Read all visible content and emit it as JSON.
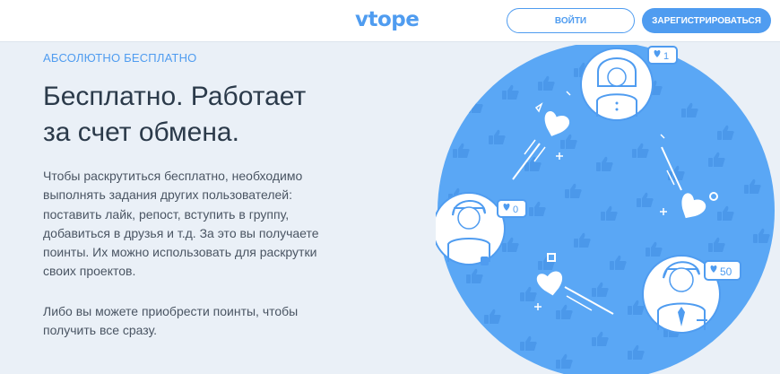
{
  "header": {
    "logo": "vtope",
    "login_label": "ВОЙТИ",
    "register_label": "ЗАРЕГИСТРИРОВАТЬСЯ"
  },
  "main": {
    "kicker": "АБСОЛЮТНО БЕСПЛАТНО",
    "title_line1": "Бесплатно. Работает",
    "title_line2": "за счет обмена.",
    "paragraph1_lines": [
      "Чтобы раскрутиться бесплатно, необходимо",
      "выполнять задания других пользователей:",
      "поставить лайк, репост, вступить в группу,",
      "добавиться в друзья и т.д. За это вы получаете",
      "поинты. Их можно использовать для раскрутки",
      "своих проектов."
    ],
    "paragraph2_lines": [
      "Либо вы можете приобрести поинты, чтобы",
      "получить все сразу."
    ]
  },
  "illustration": {
    "like_counts": {
      "top": "1",
      "left": "0",
      "right": "50"
    },
    "colors": {
      "circle": "#5aa7f5",
      "accent": "#4f9cf0",
      "white": "#ffffff"
    }
  }
}
